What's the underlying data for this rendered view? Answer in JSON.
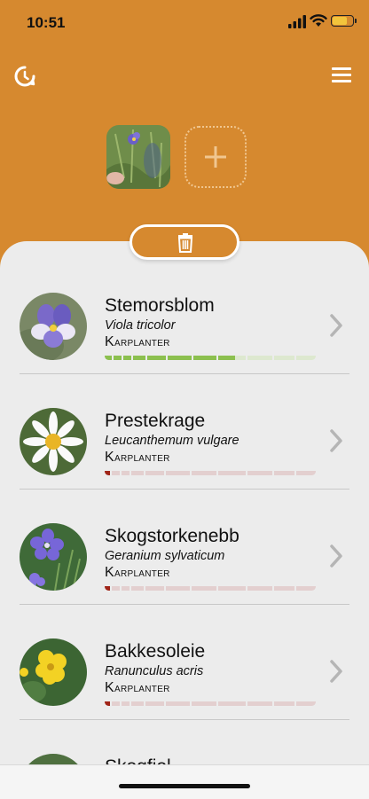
{
  "status_bar": {
    "time": "10:51"
  },
  "colors": {
    "accent": "#d6892f",
    "progress_green": "#8cc04f",
    "progress_red": "#a02518",
    "progress_pale_red": "#e3cfcf",
    "progress_pale_green": "#dde8cf"
  },
  "header": {
    "history_icon": "history-icon",
    "menu_icon": "menu-icon",
    "add_photo_icon": "plus-icon"
  },
  "actions": {
    "delete_icon": "trash-icon"
  },
  "results": [
    {
      "common_name": "Stemorsblom",
      "scientific_name": "Viola tricolor",
      "category": "Karplanter",
      "confidence": 0.62,
      "level": "high"
    },
    {
      "common_name": "Prestekrage",
      "scientific_name": "Leucanthemum vulgare",
      "category": "Karplanter",
      "confidence": 0.02,
      "level": "low"
    },
    {
      "common_name": "Skogstorkenebb",
      "scientific_name": "Geranium sylvaticum",
      "category": "Karplanter",
      "confidence": 0.02,
      "level": "low"
    },
    {
      "common_name": "Bakkesoleie",
      "scientific_name": "Ranunculus acris",
      "category": "Karplanter",
      "confidence": 0.02,
      "level": "low"
    },
    {
      "common_name": "Skogfiol",
      "scientific_name": "",
      "category": "",
      "confidence": null,
      "level": "low"
    }
  ]
}
